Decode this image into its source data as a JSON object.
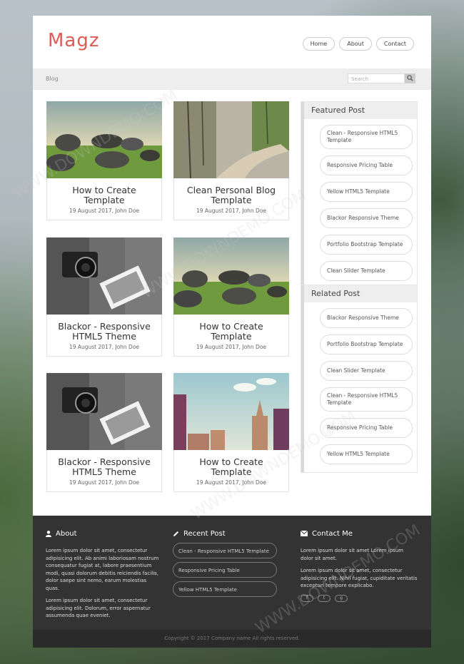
{
  "brand": {
    "logo": "Magz",
    "accent": "#e15b55"
  },
  "topnav": [
    "Home",
    "About",
    "Contact"
  ],
  "breadcrumb": "Blog",
  "search": {
    "placeholder": "Search"
  },
  "posts": [
    {
      "title": "How to Create Template",
      "meta": "19 August 2017, John Doe",
      "image": "rocks-field"
    },
    {
      "title": "Clean Personal Blog Template",
      "meta": "19 August 2017, John Doe",
      "image": "forest-road"
    },
    {
      "title": "Blackor - Responsive HTML5 Theme",
      "meta": "19 August 2017, John Doe",
      "image": "camera-photo"
    },
    {
      "title": "How to Create Template",
      "meta": "19 August 2017, John Doe",
      "image": "rocks-field"
    },
    {
      "title": "Blackor - Responsive HTML5 Theme",
      "meta": "19 August 2017, John Doe",
      "image": "camera-photo"
    },
    {
      "title": "How to Create Template",
      "meta": "19 August 2017, John Doe",
      "image": "city-rainbow"
    }
  ],
  "featured": {
    "title": "Featured Post",
    "items": [
      "Clean - Responsive HTML5 Template",
      "Responsive Pricing Table",
      "Yellow HTML5 Template",
      "Blackor Responsive Theme",
      "Portfolio Bootstrap Template",
      "Clean Slider Template"
    ]
  },
  "related": {
    "title": "Related Post",
    "items": [
      "Blackor Responsive Theme",
      "Portfolio Bootstrap Template",
      "Clean Slider Template",
      "Clean - Responsive HTML5 Template",
      "Responsive Pricing Table",
      "Yellow HTML5 Template"
    ]
  },
  "footer": {
    "about": {
      "title": "About",
      "p1": "Lorem ipsum dolor sit amet, consectetur adipisicing elit. Ab animi laboriosam nostrum consequatur fugiat at, labore praesentium modi, quasi dolorum debitis reiciendis facilis, dolor saepe sint nemo, earum molestias quas.",
      "p2": "Lorem ipsum dolor sit amet, consectetur adipisicing elit. Dolorum, error aspernatur assumenda quae eveniet."
    },
    "recent": {
      "title": "Recent Post",
      "items": [
        "Clean - Responsive HTML5 Template",
        "Responsive Pricing Table",
        "Yellow HTML5 Template"
      ]
    },
    "contact": {
      "title": "Contact Me",
      "p1": "Lorem ipsum dolor sit amet Lorem ipsum dolor sit amet.",
      "p2": "Lorem ipsum dolor sit amet, consectetur adipisicing elit. Nihil fugiat, cupiditate veritatis excepturi tempore explicabo.",
      "social": [
        "f",
        "t",
        "g"
      ]
    },
    "copyright": "Copyright © 2017 Company name All rights reserved.",
    "watermark": "WWW.DOWNDEMO.COM"
  }
}
